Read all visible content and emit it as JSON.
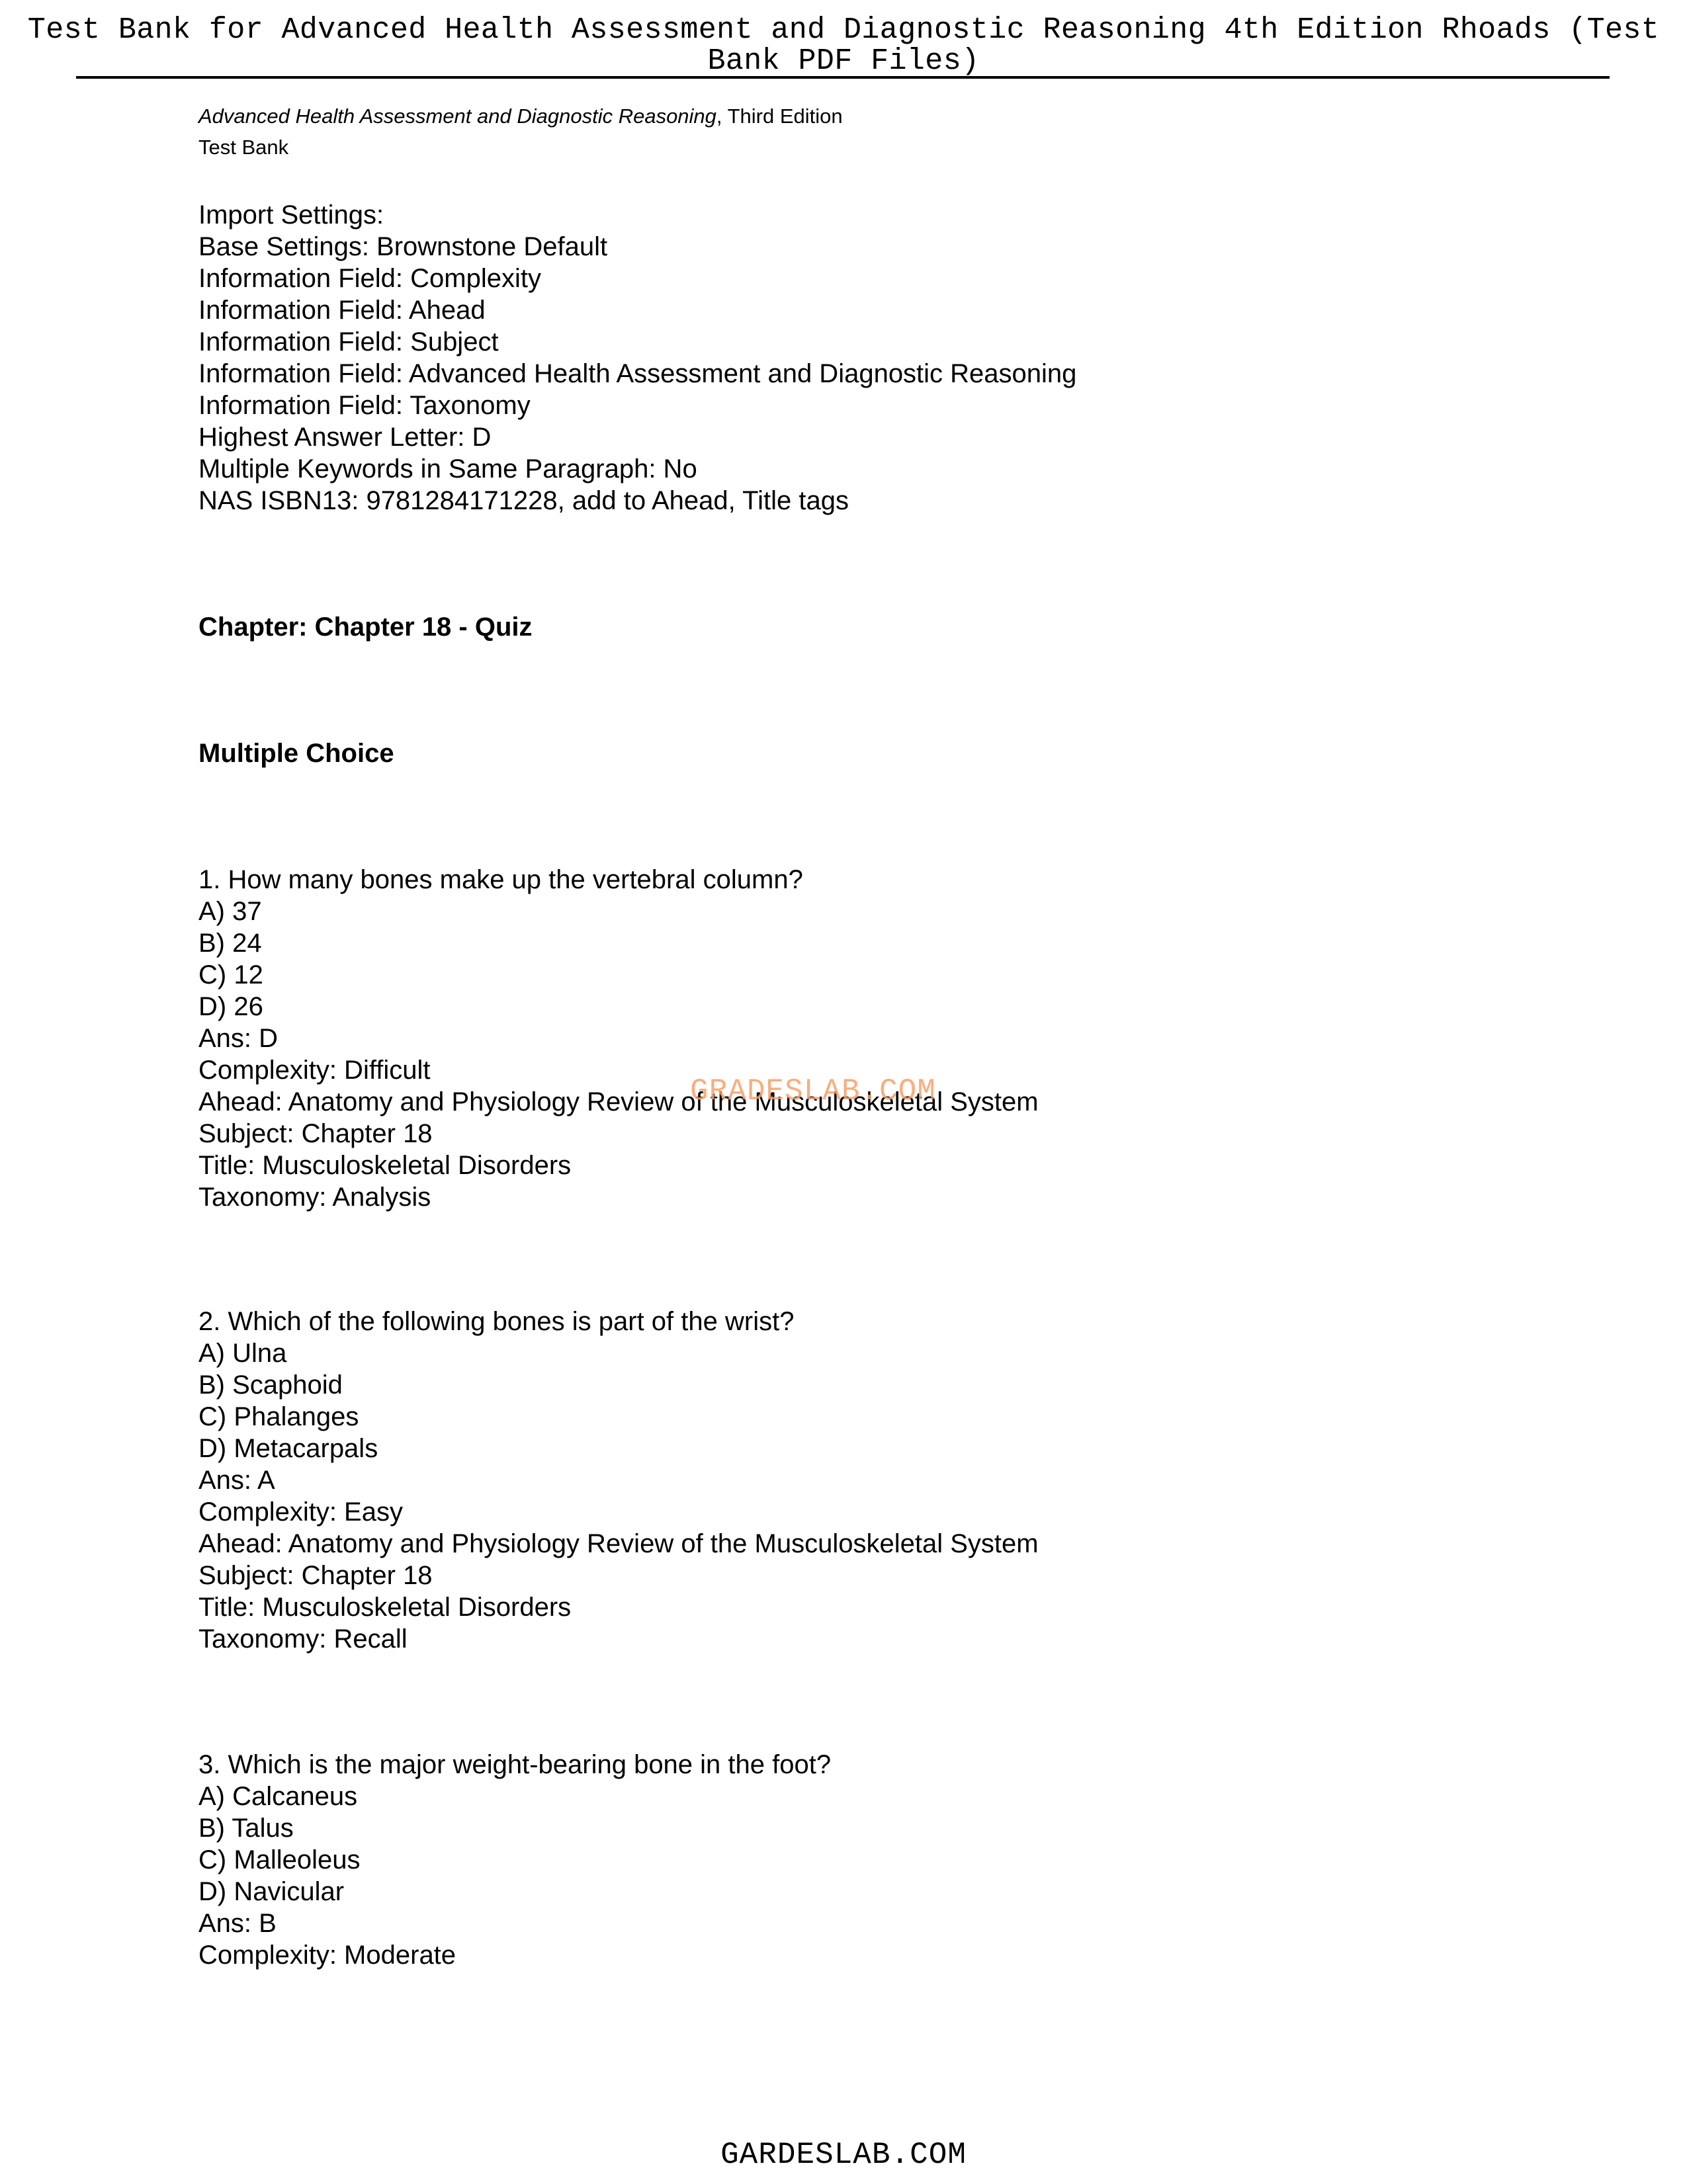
{
  "header": {
    "title_line1": "Test Bank for Advanced Health Assessment and Diagnostic Reasoning 4th Edition Rhoads (Test",
    "title_line2": "Bank PDF Files)"
  },
  "subtitle": {
    "book_title": "Advanced Health Assessment and Diagnostic Reasoning",
    "edition": ", Third Edition",
    "label": "Test Bank"
  },
  "import_settings": [
    "Import Settings:",
    "Base Settings: Brownstone Default",
    "Information Field: Complexity",
    "Information Field: Ahead",
    "Information Field: Subject",
    "Information Field: Advanced Health Assessment and Diagnostic Reasoning",
    "Information Field: Taxonomy",
    "Highest Answer Letter: D",
    "Multiple Keywords in Same Paragraph: No",
    "NAS ISBN13: 9781284171228, add to Ahead, Title tags"
  ],
  "chapter_heading": "Chapter: Chapter 18 - Quiz",
  "section_heading": "Multiple Choice",
  "questions": [
    {
      "question": "1. How many bones make up the vertebral column?",
      "options": [
        "A) 37",
        "B) 24",
        "C) 12",
        "D) 26"
      ],
      "answer": "Ans: D",
      "complexity": "Complexity: Difficult",
      "ahead": "Ahead: Anatomy and Physiology Review of the Musculoskeletal System",
      "subject": "Subject: Chapter 18",
      "title": "Title: Musculoskeletal Disorders",
      "taxonomy": "Taxonomy: Analysis"
    },
    {
      "question": "2. Which of the following bones is part of the wrist?",
      "options": [
        "A) Ulna",
        "B) Scaphoid",
        "C) Phalanges",
        "D) Metacarpals"
      ],
      "answer": "Ans: A",
      "complexity": "Complexity: Easy",
      "ahead": "Ahead: Anatomy and Physiology Review of the Musculoskeletal System",
      "subject": "Subject: Chapter 18",
      "title": "Title: Musculoskeletal Disorders",
      "taxonomy": "Taxonomy: Recall"
    },
    {
      "question": "3. Which is the major weight-bearing bone in the foot?",
      "options": [
        "A) Calcaneus",
        "B) Talus",
        "C) Malleoleus",
        "D) Navicular"
      ],
      "answer": "Ans: B",
      "complexity": "Complexity: Moderate"
    }
  ],
  "watermark": "GRADESLAB.COM",
  "footer": "GARDESLAB.COM",
  "colors": {
    "watermark": "#f6a06a",
    "text": "#000000",
    "background": "#ffffff"
  }
}
